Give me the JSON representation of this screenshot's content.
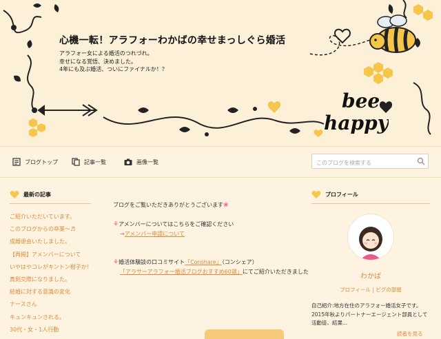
{
  "header": {
    "title": "心機一転！アラフォーわかばの幸せまっしぐら婚活",
    "description_lines": [
      "アラフォー女による婚活のつれづれ。",
      "幸せになる覚悟、決めました。",
      "4年にも及ぶ婚活、ついにファイナルか！？"
    ],
    "logo_text_1": "bee",
    "logo_text_2": "happy"
  },
  "nav": {
    "items": [
      {
        "label": "ブログトップ",
        "icon": "blog-top-icon"
      },
      {
        "label": "記事一覧",
        "icon": "article-list-icon"
      },
      {
        "label": "画像一覧",
        "icon": "camera-icon"
      }
    ],
    "search_placeholder": "このブログを検索する"
  },
  "sidebar_left": {
    "heading": "最新の記事",
    "items": [
      "ご紹介いただいています。",
      "このブログからの卒業〜♬",
      "成婚退会いたしました。",
      "【再掲】アメンバーについて",
      "いやはやコレがキントン柑子か！？",
      "真剣交際になりました。",
      "結婚に対する意識の変化",
      "ナースさん",
      "キュンキュンされる。",
      "30代・女・1人行動"
    ]
  },
  "main": {
    "greeting": "ブログをご覧いただきありがとうございます",
    "amember_text": "アメンバーについてはこちらをご確認ください",
    "amember_link": "アメンバー申請について",
    "review_intro_a": "婚活体験談の口コミサイト",
    "review_site_link": "「Conshare」",
    "review_intro_b": "（コンシェア）",
    "review_article_link": "「アラサーアラフォー婚活ブログおすすめ60選」",
    "review_intro_c": "にてご紹介いただきました"
  },
  "sidebar_right": {
    "heading": "プロフィール",
    "name": "わかば",
    "profile_link": "プロフィール",
    "separator": "|",
    "pigg_link": "ピグの部屋",
    "intro": "自己紹介:地方在住のアラフォー婚活女子です。2015年秋よりパートナーエージェント部員として活動徒、結果...",
    "read_more": "読者を見る"
  },
  "colors": {
    "background": "#fdf3e0",
    "accent": "#e08a39",
    "bee_yellow": "#f5c64a",
    "link_pink": "#e85c8a"
  }
}
